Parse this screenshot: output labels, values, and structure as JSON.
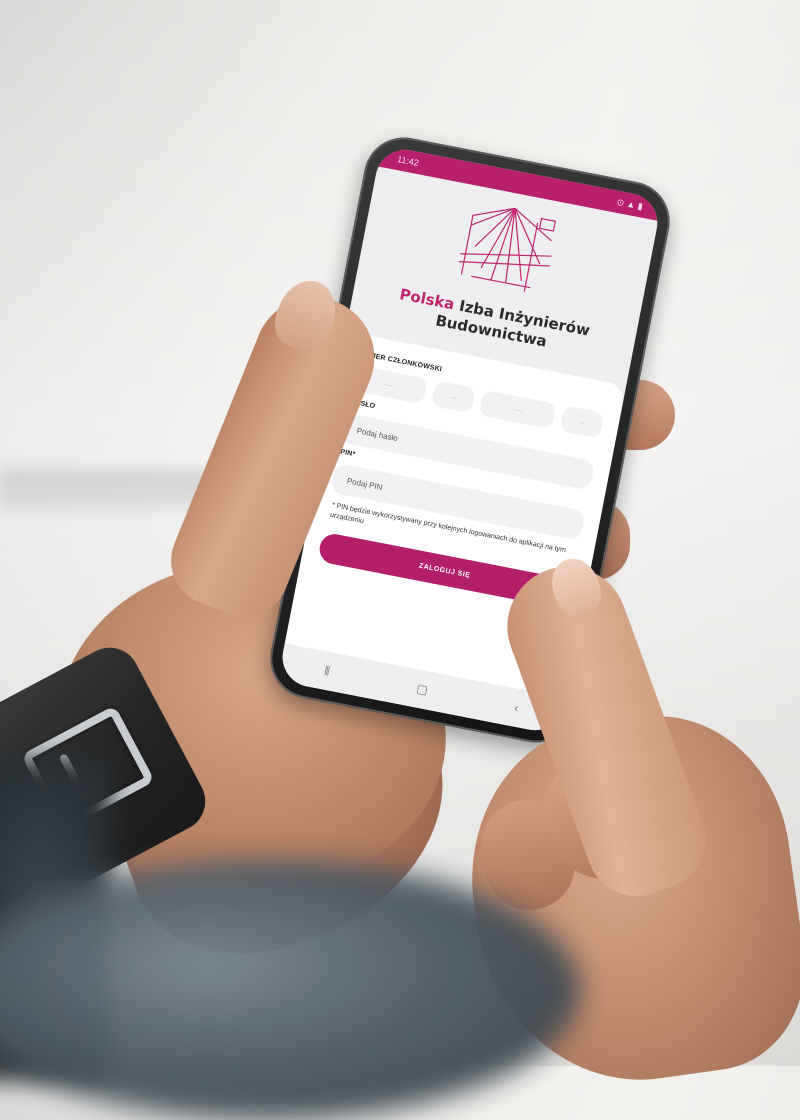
{
  "status_bar": {
    "time": "11:42",
    "icons": "⊙ ▲ ▮"
  },
  "logo": {
    "name": "bridge-logo"
  },
  "organization": {
    "accent_word": "Polska",
    "rest_line1": "Izba Inżynierów",
    "line2": "Budownictwa"
  },
  "form": {
    "member_label": "NUMER CZŁONKOWSKI",
    "member_boxes": [
      "-------",
      "----",
      "-------",
      "----"
    ],
    "password_label": "HASŁO",
    "password_placeholder": "Podaj hasło",
    "pin_label": "PIN*",
    "pin_placeholder": "Podaj PIN",
    "pin_hint": "* PIN będzie wykorzystywany przy kolejnych logowaniach do aplikacji na tym urządzeniu",
    "login_button": "ZALOGUJ SIĘ"
  },
  "nav": {
    "recent": "⦀",
    "home": "▢",
    "back": "‹"
  },
  "colors": {
    "brand": "#b8206d",
    "accent_text": "#c2256f"
  }
}
